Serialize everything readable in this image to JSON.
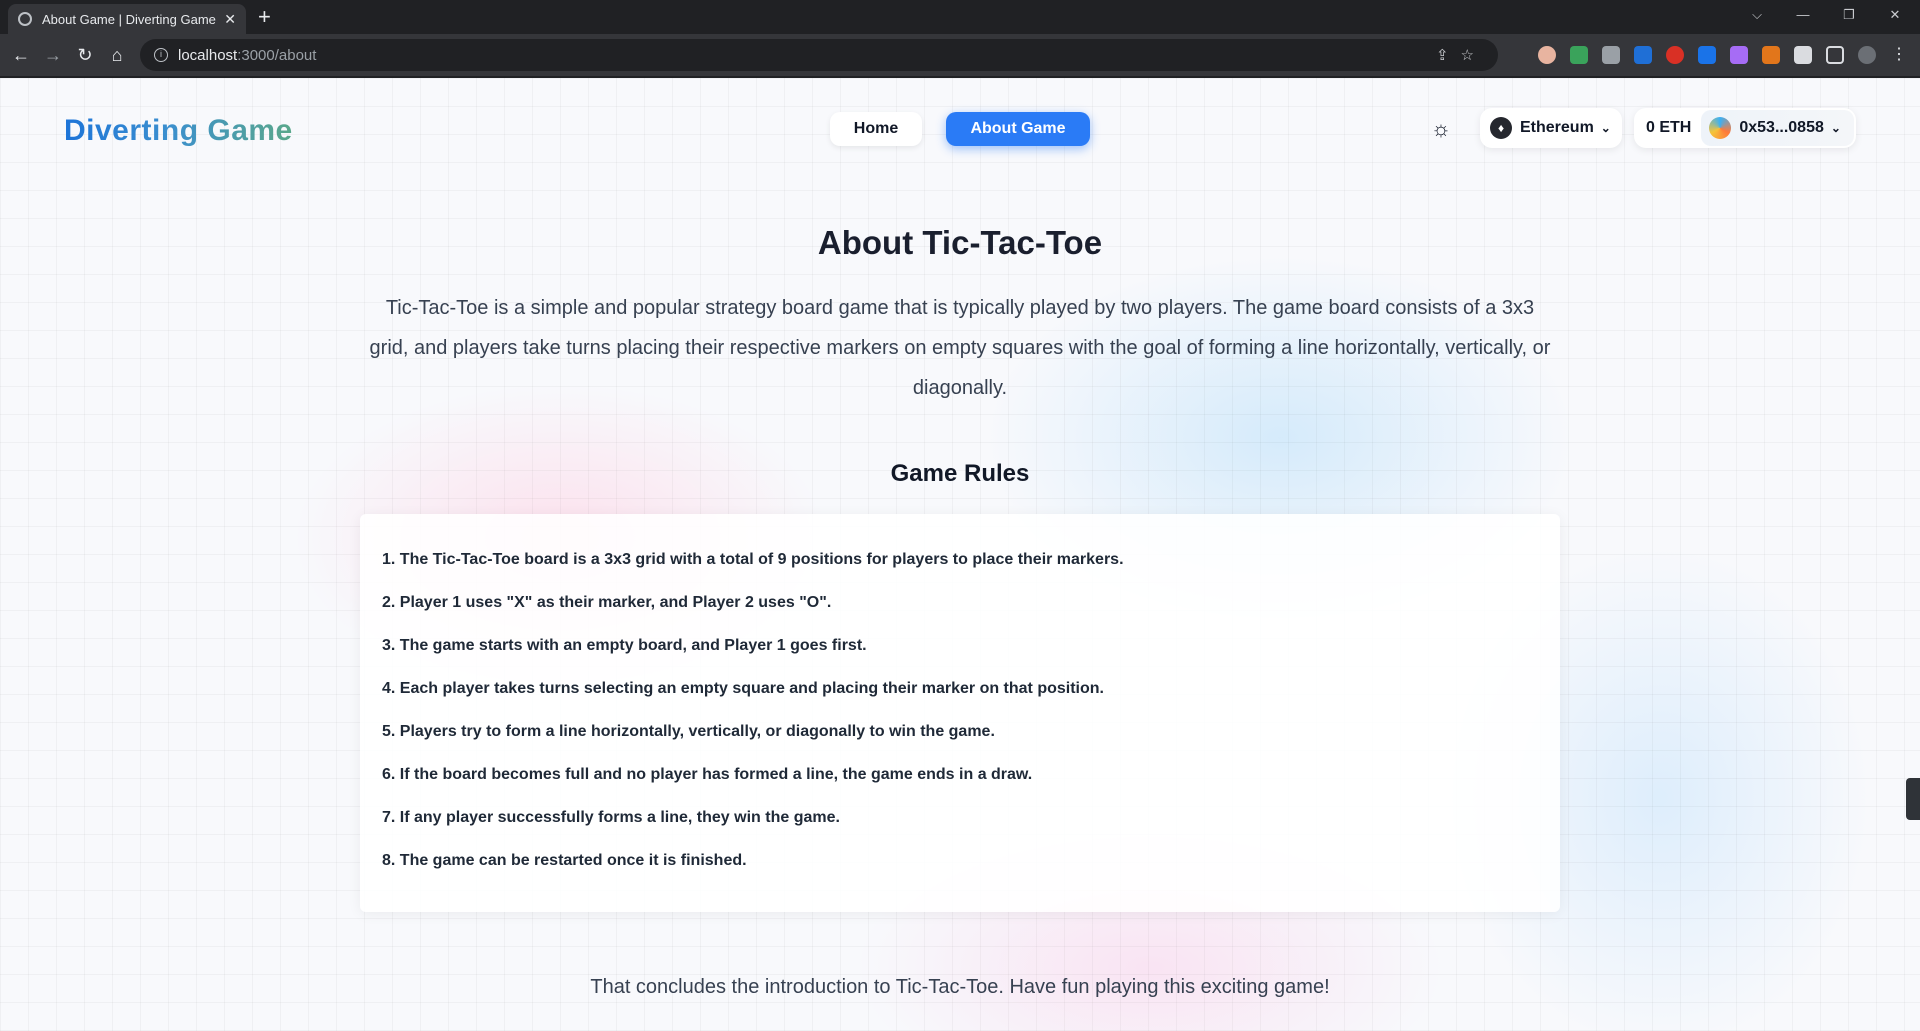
{
  "browser": {
    "tab_title": "About Game | Diverting Game",
    "tab_close": "✕",
    "new_tab": "+",
    "url_host": "localhost",
    "url_path": ":3000/about",
    "win_min": "—",
    "win_restore": "❐",
    "win_close": "✕",
    "win_dropdown": "⌵"
  },
  "header": {
    "logo": "Diverting Game",
    "nav": {
      "home": "Home",
      "about": "About Game"
    },
    "network": {
      "label": "Ethereum",
      "icon": "ethereum-icon"
    },
    "balance": "0 ETH",
    "address": "0x53...0858"
  },
  "main": {
    "title": "About Tic-Tac-Toe",
    "intro": "Tic-Tac-Toe is a simple and popular strategy board game that is typically played by two players. The game board consists of a 3x3 grid, and players take turns placing their respective markers on empty squares with the goal of forming a line horizontally, vertically, or diagonally.",
    "rules_title": "Game Rules",
    "rules": [
      "1. The Tic-Tac-Toe board is a 3x3 grid with a total of 9 positions for players to place their markers.",
      "2. Player 1 uses \"X\" as their marker, and Player 2 uses \"O\".",
      "3. The game starts with an empty board, and Player 1 goes first.",
      "4. Each player takes turns selecting an empty square and placing their marker on that position.",
      "5. Players try to form a line horizontally, vertically, or diagonally to win the game.",
      "6. If the board becomes full and no player has formed a line, the game ends in a draw.",
      "7. If any player successfully forms a line, they win the game.",
      "8. The game can be restarted once it is finished."
    ],
    "outro": "That concludes the introduction to Tic-Tac-Toe. Have fun playing this exciting game!"
  },
  "colors": {
    "accent": "#2a7bf6",
    "logo_start": "#1d74d8",
    "logo_end": "#5aa88a",
    "text": "#111827"
  }
}
